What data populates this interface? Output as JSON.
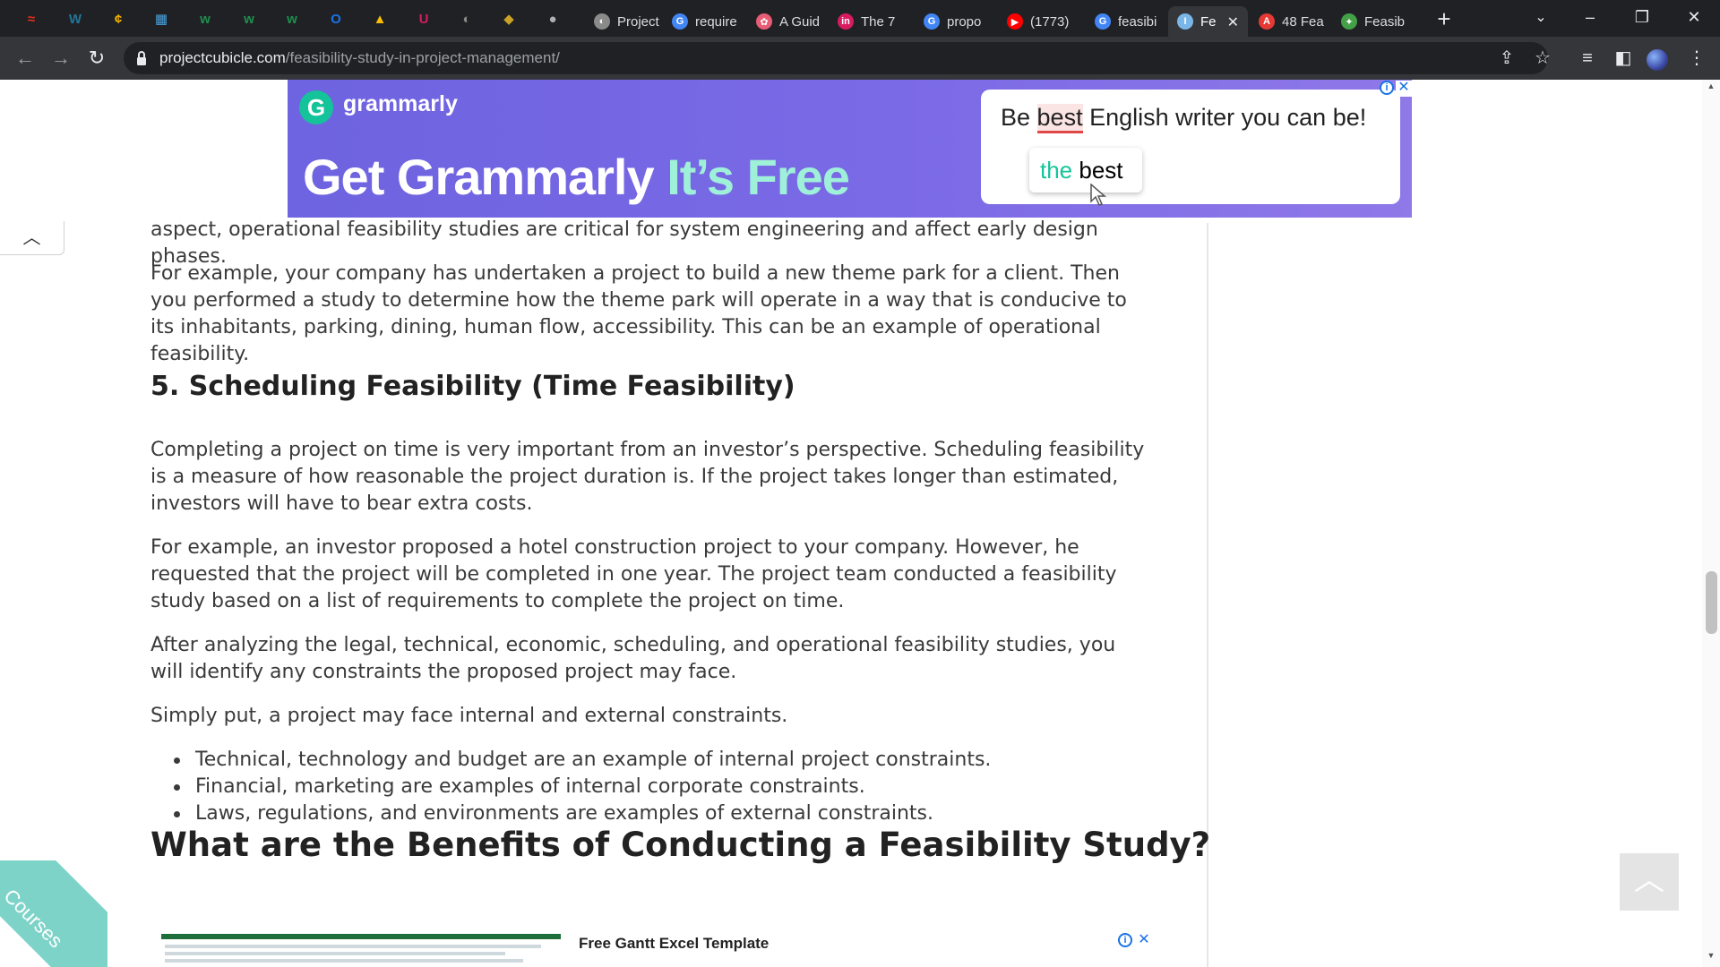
{
  "browser": {
    "pinned_icons": [
      {
        "name": "pinned-app-icon",
        "glyph": "≈",
        "color": "#e0301e"
      },
      {
        "name": "wordpress-icon",
        "glyph": "W",
        "color": "#21759b"
      },
      {
        "name": "coin-icon",
        "glyph": "¢",
        "color": "#f5b300"
      },
      {
        "name": "calendar-icon",
        "glyph": "▦",
        "color": "#4aa3df"
      },
      {
        "name": "w-icon",
        "glyph": "w",
        "color": "#1f8f4e"
      },
      {
        "name": "w-icon",
        "glyph": "w",
        "color": "#1f8f4e"
      },
      {
        "name": "w-icon",
        "glyph": "w",
        "color": "#1f8f4e"
      },
      {
        "name": "outlook-icon",
        "glyph": "O",
        "color": "#1a73e8"
      },
      {
        "name": "drive-icon",
        "glyph": "▲",
        "color": "#fbbc04"
      },
      {
        "name": "u-icon",
        "glyph": "U",
        "color": "#d81b60"
      },
      {
        "name": "globe-icon",
        "glyph": "◐",
        "color": "#8a8a8a"
      },
      {
        "name": "shield-icon",
        "glyph": "◆",
        "color": "#c9a227"
      },
      {
        "name": "ninja-icon",
        "glyph": "●",
        "color": "#b0b0b0"
      }
    ],
    "tabs": [
      {
        "label": "Project",
        "fav": "◐",
        "color": "#8a8a8a",
        "active": false
      },
      {
        "label": "require",
        "fav": "G",
        "color": "#4285f4",
        "active": false
      },
      {
        "label": "A Guid",
        "fav": "✿",
        "color": "#e85d75",
        "active": false
      },
      {
        "label": "The 7",
        "fav": "in",
        "color": "#d81b60",
        "active": false
      },
      {
        "label": "propo",
        "fav": "G",
        "color": "#4285f4",
        "active": false
      },
      {
        "label": "(1773)",
        "fav": "▶",
        "color": "#ff0000",
        "active": false
      },
      {
        "label": "feasibi",
        "fav": "G",
        "color": "#4285f4",
        "active": false
      },
      {
        "label": "Fe",
        "fav": "I",
        "color": "#7ab7e8",
        "active": true
      },
      {
        "label": "48 Fea",
        "fav": "A",
        "color": "#e53935",
        "active": false
      },
      {
        "label": "Feasib",
        "fav": "✦",
        "color": "#43a047",
        "active": false
      }
    ],
    "new_tab": "+",
    "url_host": "projectcubicle.com",
    "url_path": "/feasibility-study-in-project-management/"
  },
  "ads": {
    "top": {
      "brand": "grammarly",
      "brand_initial": "G",
      "headline_a": "Get Grammarly ",
      "headline_b": "It’s Free",
      "card_pre": "Be ",
      "card_err": "best",
      "card_post": " English writer you can be!",
      "suggestion_a": "the",
      "suggestion_b": " best"
    },
    "bottom": {
      "title": "Free Gantt Excel Template"
    }
  },
  "article": {
    "p1": "aspect, operational feasibility studies are critical for system engineering and affect early design phases.",
    "p2": "For example, your company has undertaken a project to build a new theme park for a client. Then you performed a study to determine how the theme park will operate in a way that is conducive to its inhabitants, parking, dining, human flow, accessibility. This can be an example of operational feasibility.",
    "h_sched": "5. Scheduling Feasibility (Time Feasibility)",
    "p3": "Completing a project on time is very important from an investor’s perspective. Scheduling feasibility is a measure of how reasonable the project duration is. If the project takes longer than estimated, investors will have to bear extra costs.",
    "p4": "For example, an investor proposed a hotel construction project to your company. However, he requested that the project will be completed in one year. The project team conducted a feasibility study based on a list of requirements to complete the project on time.",
    "p5": "After analyzing the legal, technical, economic, scheduling, and operational feasibility studies, you will identify any constraints the proposed project may face.",
    "p6": "Simply put, a project may face internal and external constraints.",
    "bullets": [
      "Technical, technology and budget are an example of internal project constraints.",
      "Financial, marketing are examples of internal corporate constraints.",
      "Laws, regulations, and environments are examples of external constraints."
    ],
    "h_benefits": "What are the Benefits of Conducting a Feasibility Study?"
  },
  "widgets": {
    "courses_label": "Courses"
  }
}
